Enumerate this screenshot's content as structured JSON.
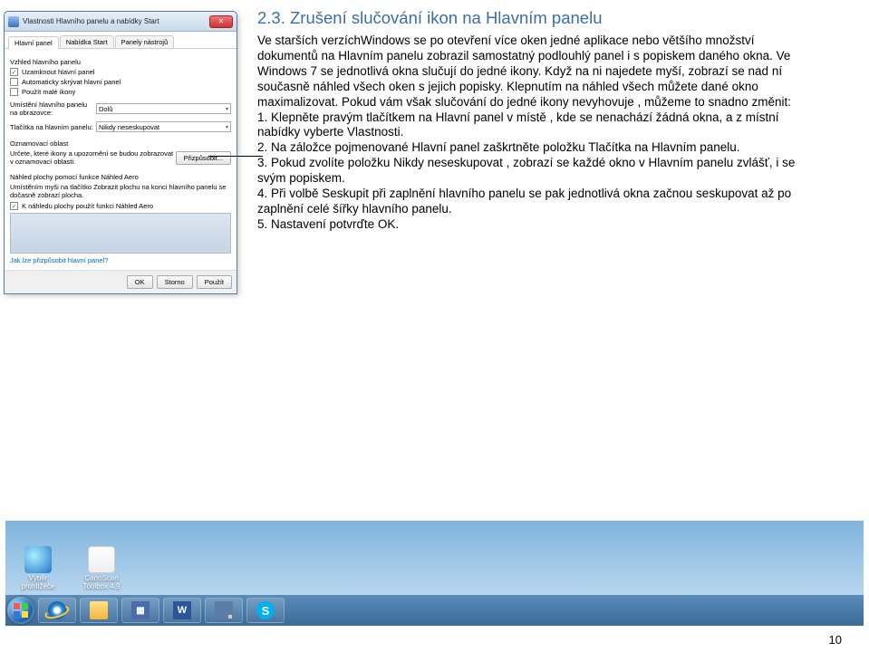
{
  "heading": "2.3. Zrušení slučování ikon na Hlavním panelu",
  "paragraphs": [
    "Ve starších verzíchWindows se po otevření více oken jedné aplikace nebo většího množství dokumentů na Hlavním panelu zobrazil samostatný podlouhlý panel i s popiskem daného okna. Ve Windows 7 se jednotlivá okna slučují do jedné ikony. Když na ni najedete myší, zobrazí se nad ní současně náhled všech oken s jejich popisky. Klepnutím na náhled všech můžete dané okno maximalizovat. Pokud vám však slučování do jedné ikony nevyhovuje , můžeme to snadno změnit:",
    "  1. Klepněte pravým tlačítkem na Hlavní panel v místě , kde se nenachází žádná okna, a z místní nabídky vyberte Vlastnosti.",
    "  2. Na záložce pojmenované Hlavní panel zaškrtněte položku Tlačítka na Hlavním panelu.",
    "  3. Pokud zvolíte položku Nikdy neseskupovat , zobrazí se každé okno v Hlavním panelu zvlášť, i se svým popiskem.",
    "  4. Při volbě Seskupit při zaplnění hlavního panelu se pak jednotlivá okna začnou seskupovat až po zaplnění celé šířky hlavního panelu.",
    "  5. Nastavení potvrďte OK."
  ],
  "dialog": {
    "title": "Vlastnosti Hlavního panelu a nabídky Start",
    "tabs": [
      "Hlavní panel",
      "Nabídka Start",
      "Panely nástrojů"
    ],
    "section1": "Vzhled hlavního panelu",
    "chk_lock": "Uzamknout hlavní panel",
    "chk_autohide": "Automaticky skrývat hlavní panel",
    "chk_small": "Použít malé ikony",
    "lbl_position": "Umístění hlavního panelu na obrazovce:",
    "val_position": "Dolů",
    "lbl_buttons": "Tlačítka na hlavním panelu:",
    "val_buttons": "Nikdy neseskupovat",
    "section2": "Oznamovací oblast",
    "note_area": "Určete, které ikony a upozornění se budou zobrazovat v oznamovací oblasti.",
    "btn_customize": "Přizpůsobit...",
    "section3": "Náhled plochy pomocí funkce Náhled Aero",
    "aero_text": "Umístěním myši na tlačítko Zobrazit plochu na konci hlavního panelu se dočasně zobrazí plocha.",
    "chk_aero": "K náhledu plochy použít funkci Náhled Aero",
    "link": "Jak lze přizpůsobit hlavní panel?",
    "btn_ok": "OK",
    "btn_cancel": "Storno",
    "btn_apply": "Použít"
  },
  "desktop_icons": {
    "browser": "Výběr prohlížeče",
    "scanner": "CanoScan Toolbox 4.9"
  },
  "page_number": "10"
}
